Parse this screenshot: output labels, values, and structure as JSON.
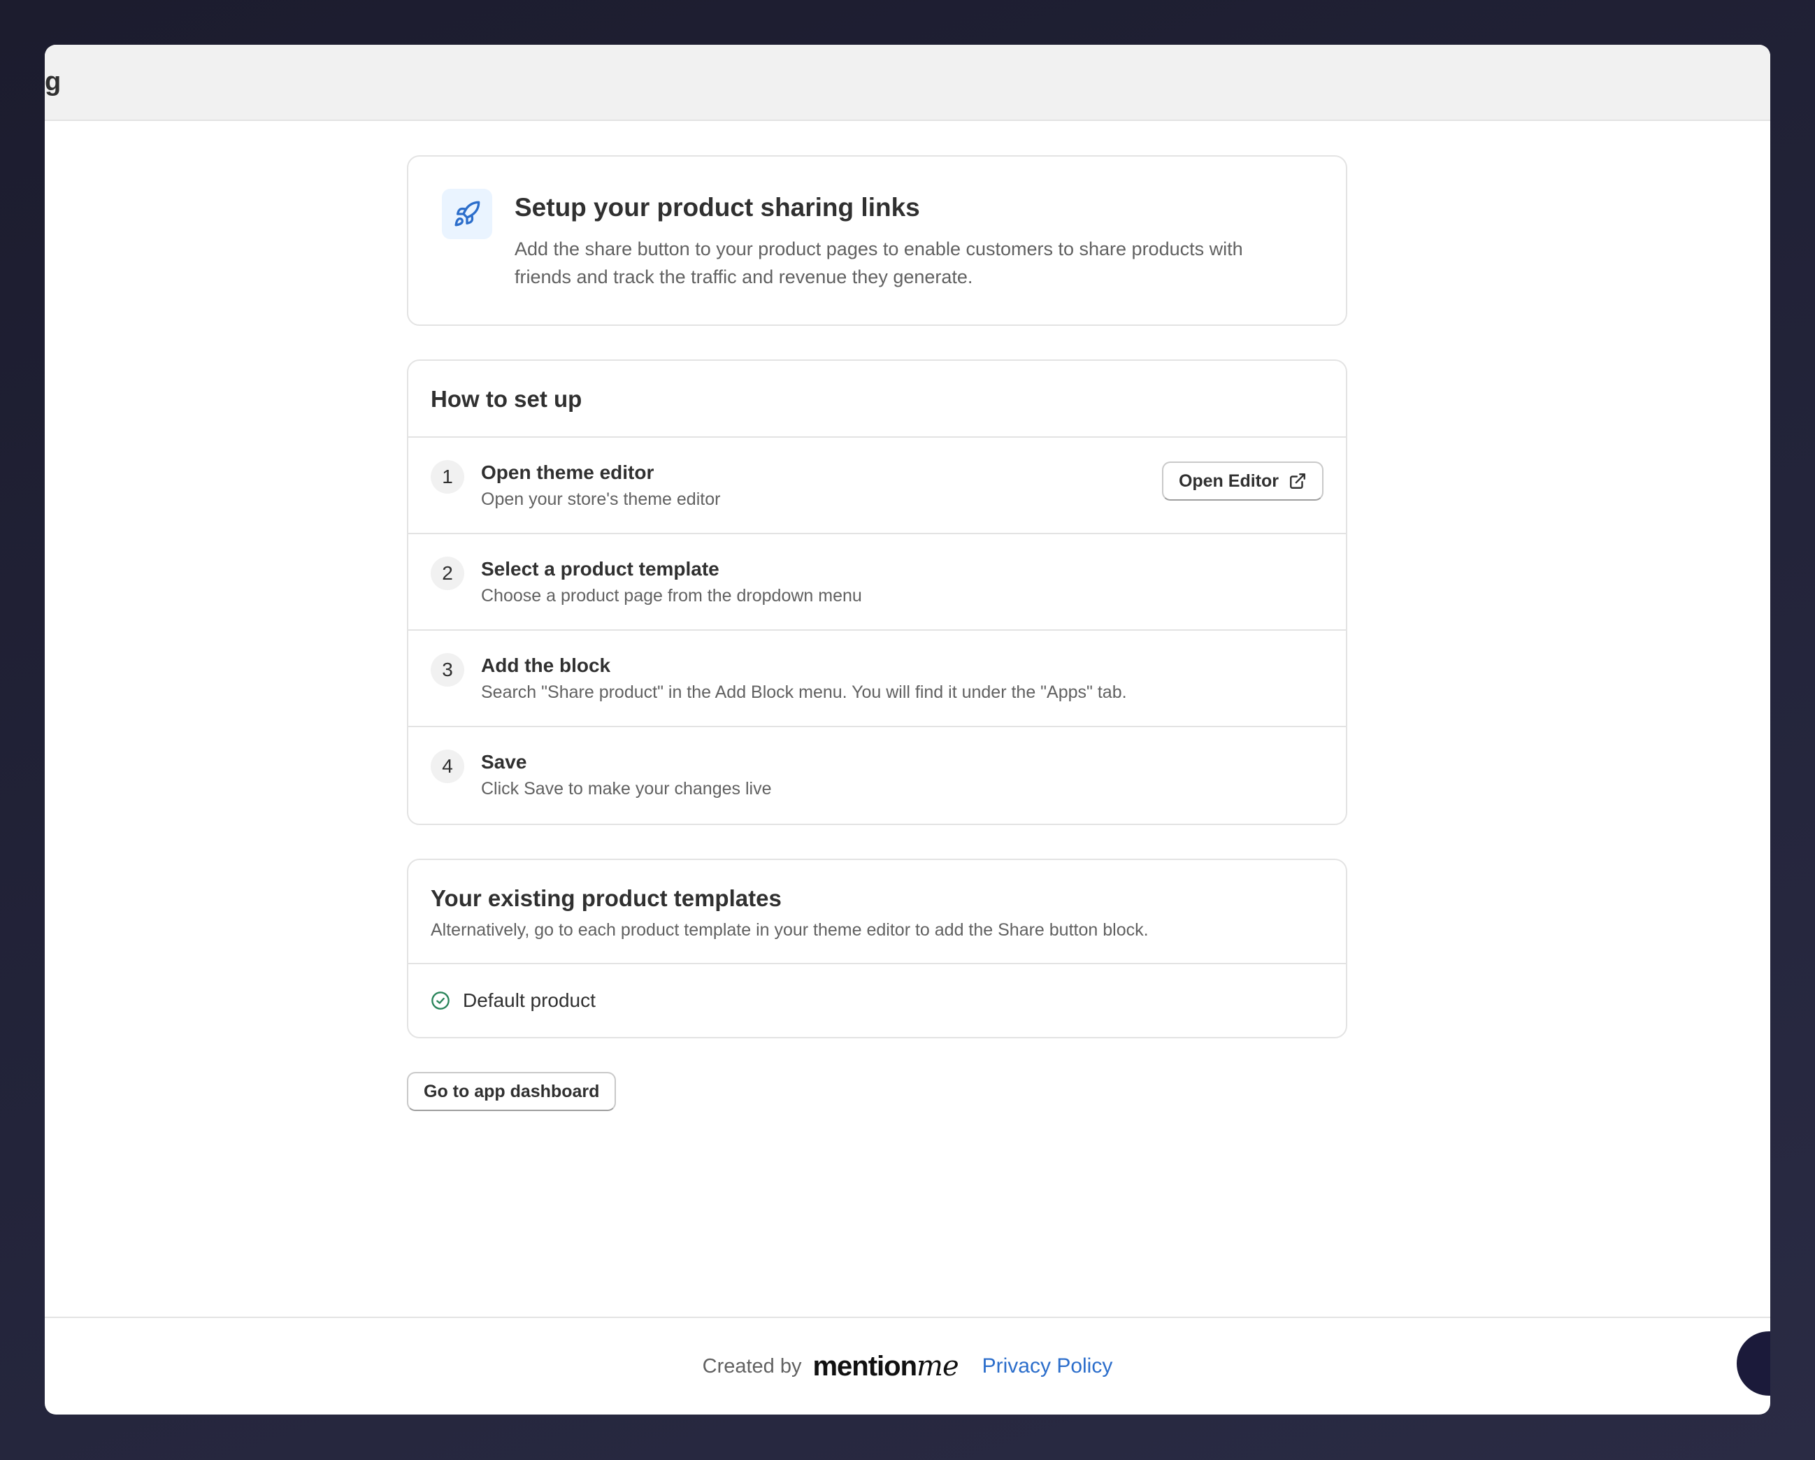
{
  "window": {
    "title_fragment": "g"
  },
  "hero": {
    "icon": "rocket-icon",
    "title": "Setup your product sharing links",
    "description": "Add the share button to your product pages to enable customers to share products with friends and track the traffic and revenue they generate."
  },
  "setup": {
    "title": "How to set up",
    "steps": [
      {
        "number": "1",
        "title": "Open theme editor",
        "description": "Open your store's theme editor"
      },
      {
        "number": "2",
        "title": "Select a product template",
        "description": "Choose a product page from the dropdown menu"
      },
      {
        "number": "3",
        "title": "Add the block",
        "description": "Search \"Share product\" in the Add Block menu. You will find it under the \"Apps\" tab."
      },
      {
        "number": "4",
        "title": "Save",
        "description": "Click Save to make your changes live"
      }
    ],
    "open_editor_label": "Open Editor"
  },
  "templates": {
    "title": "Your existing product templates",
    "subtitle": "Alternatively, go to each product template in your theme editor to add the Share button block.",
    "items": [
      {
        "label": "Default product",
        "status": "check-circle-icon"
      }
    ]
  },
  "dashboard_button": "Go to app dashboard",
  "footer": {
    "created_by": "Created by",
    "logo_main": "mention",
    "logo_script": "me",
    "privacy_label": "Privacy Policy"
  },
  "colors": {
    "accent_icon": "#2c6ecb",
    "icon_bg": "#eaf4ff",
    "success": "#29845a",
    "link": "#2c6ecb"
  }
}
